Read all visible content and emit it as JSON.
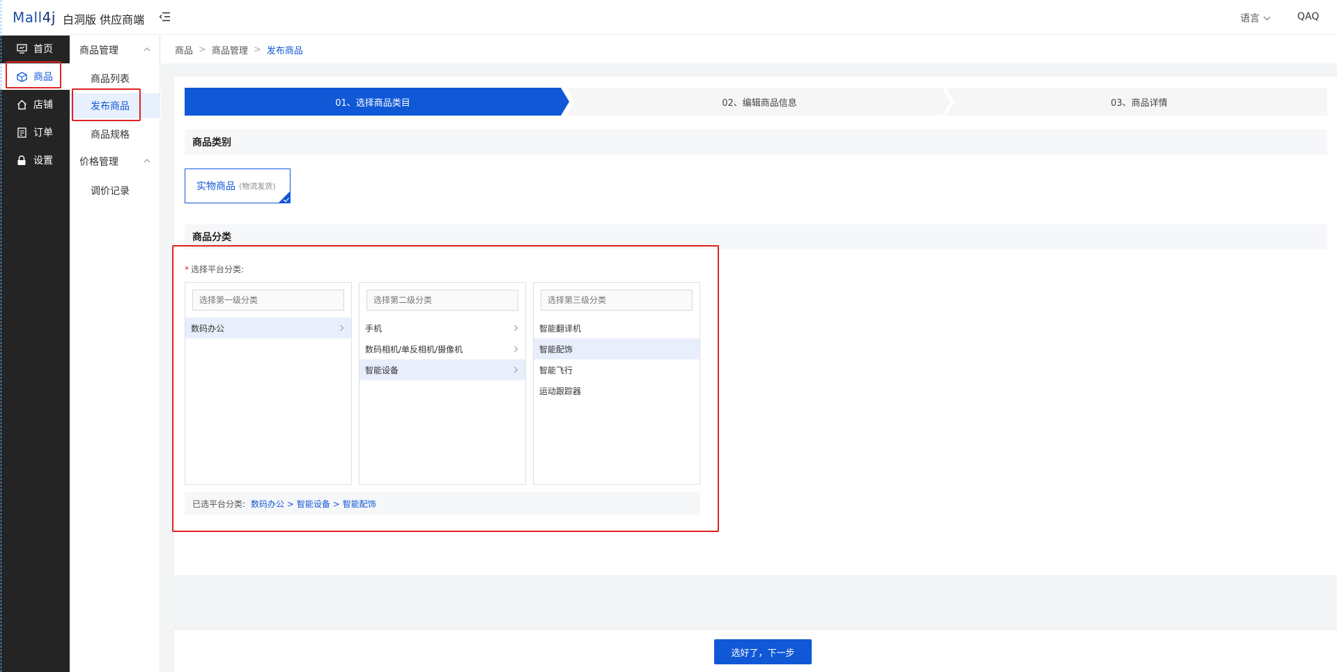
{
  "header": {
    "logo_part1": "Mall",
    "logo_part2": "4j",
    "app_title": "白洞版 供应商端",
    "language_label": "语言",
    "user_name": "QAQ"
  },
  "sidebar": {
    "items": [
      {
        "label": "首页",
        "icon": "home-monitor-icon"
      },
      {
        "label": "商品",
        "icon": "cube-icon",
        "active": true
      },
      {
        "label": "店铺",
        "icon": "shop-icon"
      },
      {
        "label": "订单",
        "icon": "order-icon"
      },
      {
        "label": "设置",
        "icon": "lock-icon"
      }
    ]
  },
  "submenu": {
    "group1": "商品管理",
    "items1": [
      "商品列表",
      "发布商品",
      "商品规格"
    ],
    "group2": "价格管理",
    "items2": [
      "调价记录"
    ]
  },
  "breadcrumb": [
    "商品",
    "商品管理",
    "发布商品"
  ],
  "steps": [
    "01、选择商品类目",
    "02、编辑商品信息",
    "03、商品详情"
  ],
  "sections": {
    "type_title": "商品类别",
    "category_title": "商品分类"
  },
  "type_card": {
    "name": "实物商品",
    "sub": "(物流发货)"
  },
  "category": {
    "required_label": "选择平台分类:",
    "col1_placeholder": "选择第一级分类",
    "col2_placeholder": "选择第二级分类",
    "col3_placeholder": "选择第三级分类",
    "col1": [
      "数码办公"
    ],
    "col2": [
      "手机",
      "数码相机/单反相机/摄像机",
      "智能设备"
    ],
    "col3": [
      "智能翻译机",
      "智能配饰",
      "智能飞行",
      "运动跟踪器"
    ],
    "selected_label": "已选平台分类:",
    "selected_path": [
      "数码办公 >",
      "智能设备 >",
      "智能配饰"
    ]
  },
  "footer": {
    "next_label": "选好了，下一步"
  },
  "colors": {
    "accent": "#1158d6",
    "sidebar_bg": "#242424",
    "highlight_red": "#e02121"
  }
}
